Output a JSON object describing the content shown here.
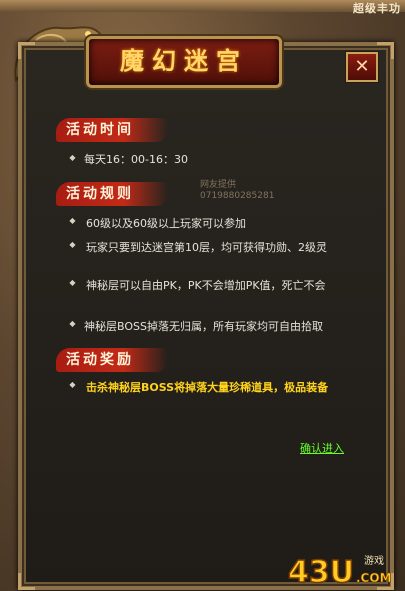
{
  "header": {
    "corner_text": "超级丰功"
  },
  "dialog": {
    "title": "魔幻迷宫",
    "close_symbol": "✕"
  },
  "sections": {
    "time": {
      "label": "活动时间",
      "items": [
        "每天16：00-16：30"
      ]
    },
    "rules": {
      "label": "活动规则",
      "items": [
        "60级以及60级以上玩家可以参加",
        "玩家只要到达迷宫第10层，均可获得功勋、2级灵",
        "神秘层可以自由PK，PK不会增加PK值，死亡不会",
        "神秘层BOSS掉落无归属，所有玩家均可自由拾取"
      ]
    },
    "rewards": {
      "label": "活动奖励",
      "items": [
        "击杀神秘层BOSS将掉落大量珍稀道具，极品装备"
      ]
    }
  },
  "watermark": {
    "line1": "网友提供",
    "line2": "0719880285281"
  },
  "confirm": {
    "label": "确认进入"
  },
  "logo": {
    "text": "43U",
    "suffix": ".COM",
    "tag": "游戏"
  },
  "colors": {
    "title": "#ffd66a",
    "highlight": "#ffd21c",
    "link": "#67ff2a",
    "section_red": "#c22a17"
  }
}
